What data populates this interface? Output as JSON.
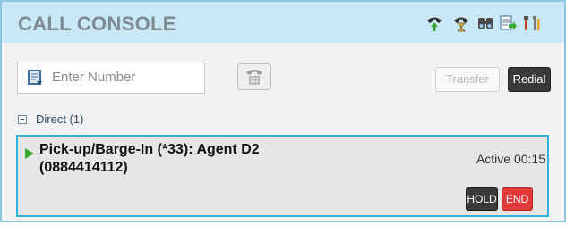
{
  "header": {
    "title": "CALL CONSOLE",
    "icons": [
      "call-forward-icon",
      "hourglass-icon",
      "directory-icon",
      "settings-icon"
    ]
  },
  "toolbar": {
    "number_placeholder": "Enter Number",
    "number_value": "",
    "transfer_label": "Transfer",
    "redial_label": "Redial"
  },
  "group": {
    "label": "Direct (1)"
  },
  "call": {
    "line1": "Pick-up/Barge-In (*33): Agent D2",
    "line2": "(0884414112)",
    "status": "Active 00:15",
    "hold_label": "HOLD",
    "end_label": "END"
  },
  "colors": {
    "header_bg": "#c9e8f6",
    "card_border": "#2fb3da",
    "end_red": "#e23a3a",
    "play_green": "#3aa82e"
  }
}
